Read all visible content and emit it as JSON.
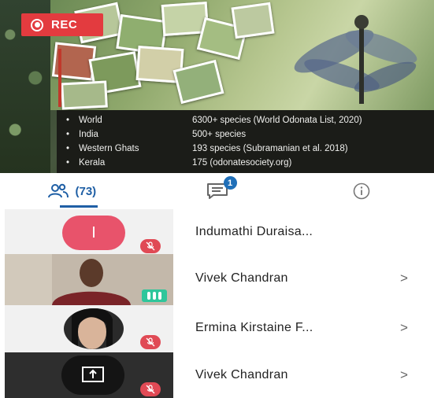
{
  "recording": {
    "label": "REC"
  },
  "slide": {
    "rows": [
      {
        "bullet": "•",
        "region": "World",
        "count": "6300+ species (World Odonata List, 2020)"
      },
      {
        "bullet": "•",
        "region": "India",
        "count": "500+ species"
      },
      {
        "bullet": "•",
        "region": "Western Ghats",
        "count": "193 species (Subramanian et al. 2018)"
      },
      {
        "bullet": "•",
        "region": "Kerala",
        "count": "175 (odonatesociety.org)"
      }
    ]
  },
  "tabs": {
    "people_count": "(73)",
    "chat_badge": "1"
  },
  "participants": [
    {
      "initial": "I",
      "name": "Indumathi Duraisa...",
      "chevron": ""
    },
    {
      "name": "Vivek Chandran",
      "chevron": ">"
    },
    {
      "name": "Ermina Kirstaine F...",
      "chevron": ">"
    },
    {
      "name": "Vivek Chandran",
      "chevron": ">"
    }
  ],
  "colors": {
    "accent": "#1f5fa5",
    "record": "#e33b3f",
    "mute": "#e04a55",
    "audio": "#2fc69b"
  }
}
